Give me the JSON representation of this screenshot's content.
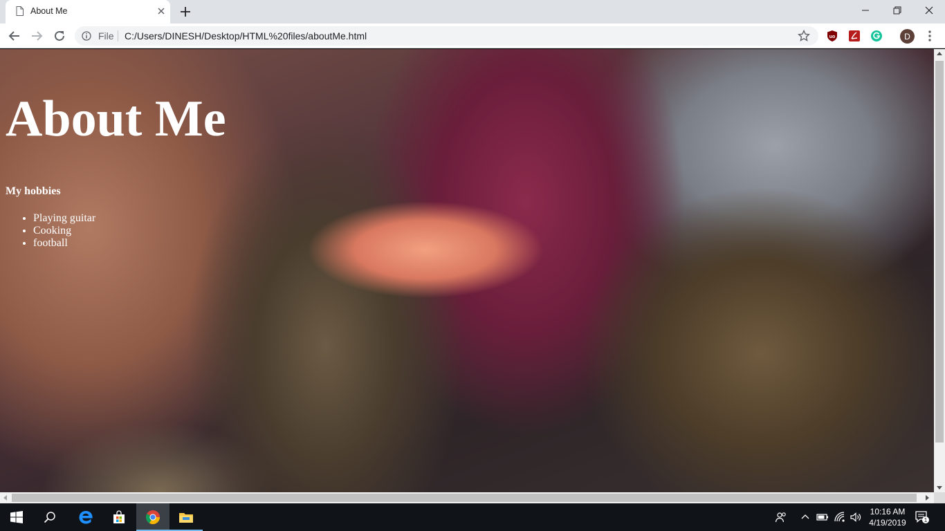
{
  "browser": {
    "tab": {
      "title": "About Me"
    },
    "address_bar": {
      "scheme_label": "File",
      "url": "C:/Users/DINESH/Desktop/HTML%20files/aboutMe.html"
    },
    "profile_initial": "D"
  },
  "page": {
    "heading": "About Me",
    "hobbies_title": "My hobbies",
    "hobbies": [
      "Playing guitar",
      "Cooking",
      "football"
    ]
  },
  "taskbar": {
    "clock": {
      "time": "10:16 AM",
      "date": "4/19/2019"
    },
    "notification_count": "1"
  }
}
